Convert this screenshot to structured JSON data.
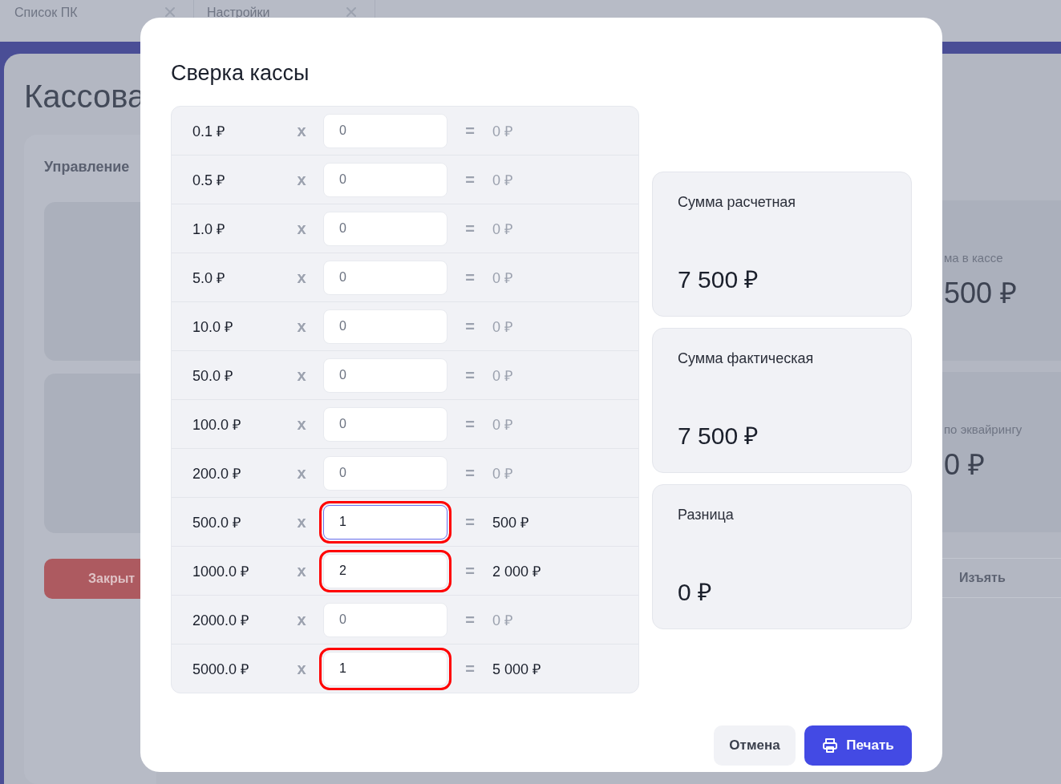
{
  "background": {
    "tabs": [
      {
        "label": "Список ПК"
      },
      {
        "label": "Настройки"
      }
    ],
    "page_title": "Кассова",
    "panel_title": "Управление",
    "close_button": "Закрыт",
    "stats": [
      {
        "label": "ма в кассе",
        "value": "500 ₽"
      },
      {
        "label": "по эквайрингу",
        "value": "0 ₽"
      }
    ],
    "withdraw_button": "Изъять"
  },
  "dialog": {
    "title": "Сверка кассы",
    "rows": [
      {
        "denomination": "0.1 ₽",
        "times": "x",
        "count": "0",
        "equals": "=",
        "total": "0 ₽",
        "dimmed": true,
        "highlighted": false,
        "focused": false
      },
      {
        "denomination": "0.5 ₽",
        "times": "x",
        "count": "0",
        "equals": "=",
        "total": "0 ₽",
        "dimmed": true,
        "highlighted": false,
        "focused": false
      },
      {
        "denomination": "1.0 ₽",
        "times": "x",
        "count": "0",
        "equals": "=",
        "total": "0 ₽",
        "dimmed": true,
        "highlighted": false,
        "focused": false
      },
      {
        "denomination": "5.0 ₽",
        "times": "x",
        "count": "0",
        "equals": "=",
        "total": "0 ₽",
        "dimmed": true,
        "highlighted": false,
        "focused": false
      },
      {
        "denomination": "10.0 ₽",
        "times": "x",
        "count": "0",
        "equals": "=",
        "total": "0 ₽",
        "dimmed": true,
        "highlighted": false,
        "focused": false
      },
      {
        "denomination": "50.0 ₽",
        "times": "x",
        "count": "0",
        "equals": "=",
        "total": "0 ₽",
        "dimmed": true,
        "highlighted": false,
        "focused": false
      },
      {
        "denomination": "100.0 ₽",
        "times": "x",
        "count": "0",
        "equals": "=",
        "total": "0 ₽",
        "dimmed": true,
        "highlighted": false,
        "focused": false
      },
      {
        "denomination": "200.0 ₽",
        "times": "x",
        "count": "0",
        "equals": "=",
        "total": "0 ₽",
        "dimmed": true,
        "highlighted": false,
        "focused": false
      },
      {
        "denomination": "500.0 ₽",
        "times": "x",
        "count": "1",
        "equals": "=",
        "total": "500 ₽",
        "dimmed": false,
        "highlighted": true,
        "focused": true
      },
      {
        "denomination": "1000.0 ₽",
        "times": "x",
        "count": "2",
        "equals": "=",
        "total": "2 000 ₽",
        "dimmed": false,
        "highlighted": true,
        "focused": false
      },
      {
        "denomination": "2000.0 ₽",
        "times": "x",
        "count": "0",
        "equals": "=",
        "total": "0 ₽",
        "dimmed": true,
        "highlighted": false,
        "focused": false
      },
      {
        "denomination": "5000.0 ₽",
        "times": "x",
        "count": "1",
        "equals": "=",
        "total": "5 000 ₽",
        "dimmed": false,
        "highlighted": true,
        "focused": false
      }
    ],
    "summary": [
      {
        "label": "Сумма расчетная",
        "value": "7 500 ₽"
      },
      {
        "label": "Сумма фактическая",
        "value": "7 500 ₽"
      },
      {
        "label": "Разница",
        "value": "0 ₽"
      }
    ],
    "buttons": {
      "cancel": "Отмена",
      "print": "Печать"
    }
  }
}
